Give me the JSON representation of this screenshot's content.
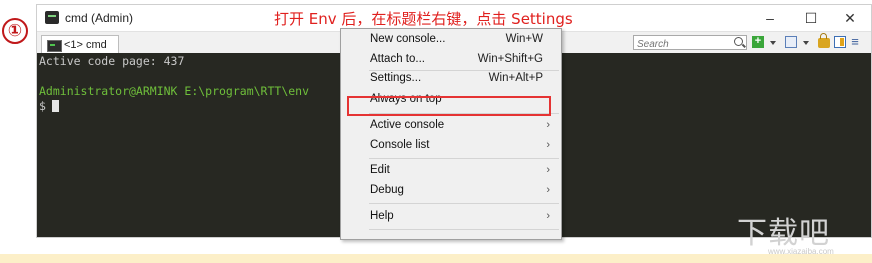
{
  "annotation": {
    "step": "①",
    "caption": "打开 Env 后，在标题栏右键，点击 Settings"
  },
  "window": {
    "title": "cmd (Admin)",
    "minimize": "–",
    "maximize": "☐",
    "close": "✕"
  },
  "toolbar": {
    "tab_label": "<1> cmd",
    "search_placeholder": "Search"
  },
  "console": {
    "lines": [
      "Active code page: 437",
      "",
      "Administrator@ARMINK E:\\program\\RTT\\env",
      "$"
    ]
  },
  "context_menu": {
    "items": [
      {
        "label": "New console...",
        "shortcut": "Win+W",
        "submenu": false
      },
      {
        "label": "Attach to...",
        "shortcut": "Win+Shift+G",
        "submenu": false
      },
      {
        "label": "Settings...",
        "shortcut": "Win+Alt+P",
        "submenu": false,
        "highlighted": true
      },
      {
        "label": "Always on top",
        "shortcut": "",
        "submenu": false
      },
      {
        "label": "Active console",
        "shortcut": "",
        "submenu": true
      },
      {
        "label": "Console list",
        "shortcut": "",
        "submenu": true
      },
      {
        "label": "Edit",
        "shortcut": "",
        "submenu": true
      },
      {
        "label": "Debug",
        "shortcut": "",
        "submenu": true
      },
      {
        "label": "Help",
        "shortcut": "",
        "submenu": true
      }
    ],
    "submenu_arrow": "›"
  },
  "watermark": {
    "text": "下载吧",
    "url": "www.xiazaiba.com"
  },
  "colors": {
    "accent_red": "#e53333",
    "console_bg": "#272822",
    "prompt_green": "#6fbf3b",
    "band": "#fcefc8"
  }
}
